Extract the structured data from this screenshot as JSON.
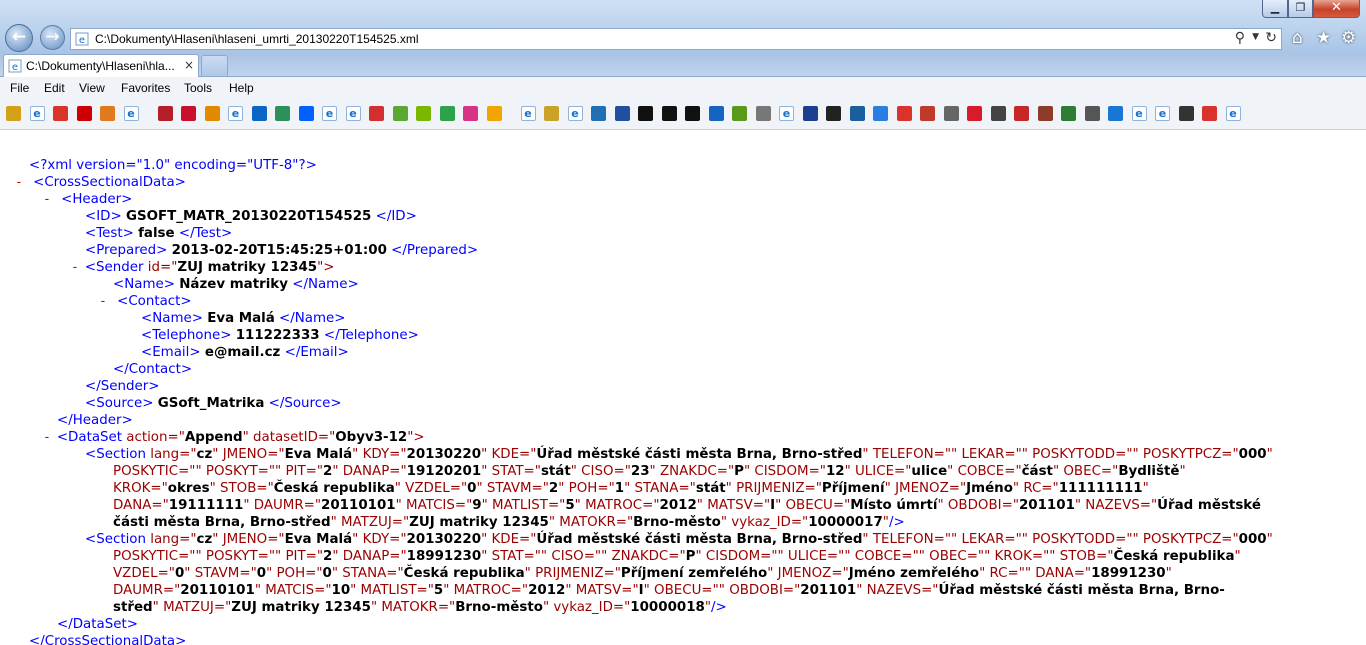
{
  "window": {
    "address": "C:\\Dokumenty\\Hlaseni\\hlaseni_umrti_20130220T154525.xml",
    "tab_label": "C:\\Dokumenty\\Hlaseni\\hla...",
    "tab_close": "×",
    "min_glyph": "▁",
    "max_glyph": "❐",
    "close_glyph": "✕",
    "back_glyph": "←",
    "forward_glyph": "→",
    "search_glyph": "⚲",
    "dropdown_glyph": "▼",
    "refresh_glyph": "↻",
    "home_glyph": "⌂",
    "favorites_glyph": "★",
    "tools_glyph": "⚙"
  },
  "menu": {
    "file": "File",
    "edit": "Edit",
    "view": "View",
    "favorites": "Favorites",
    "tools": "Tools",
    "help": "Help"
  },
  "colors": {
    "xml_markup": "#0000ff",
    "xml_tag": "#990000",
    "xml_minus": "#cc0000"
  },
  "favorites_icons": [
    "star-add",
    "ie-page",
    "tomato",
    "youtube",
    "pencil",
    "ie-page",
    "seznam",
    "target",
    "chart",
    "ie-page",
    "linkedin",
    "globe",
    "dropbox",
    "ie-page",
    "ie-page",
    "lips",
    "pinwheel",
    "y-letter",
    "stickman",
    "flower",
    "owl",
    "ie-page",
    "star",
    "ie-page",
    "book",
    "arrows",
    "circle-a",
    "circle-b",
    "circle-c",
    "puzzle",
    "map-pin",
    "doc",
    "ie-page",
    "table",
    "checker",
    "building",
    "bricks",
    "ring",
    "office",
    "tools",
    "snake",
    "monitor",
    "red-circle",
    "castle",
    "chart2",
    "diamond",
    "network",
    "ie-page",
    "ie-page",
    "list",
    "asterisk",
    "ie-page"
  ],
  "xml": {
    "decl": "<?xml version=\"1.0\" encoding=\"UTF-8\"?>",
    "minus": "-",
    "root_open": "<CrossSectionalData>",
    "header_open": "<Header>",
    "id_open": "<ID>",
    "id_val": "GSOFT_MATR_20130220T154525",
    "id_close": "</ID>",
    "test_open": "<Test>",
    "test_val": "false",
    "test_close": "</Test>",
    "prepared_open": "<Prepared>",
    "prepared_val": "2013-02-20T15:45:25+01:00",
    "prepared_close": "</Prepared>",
    "sender_open_a": "<Sender",
    "sender_attr": " id=\"",
    "sender_id": "ZUJ matriky 12345",
    "sender_open_b": "\">",
    "name_open": "<Name>",
    "sender_name": "Název matriky",
    "name_close": "</Name>",
    "contact_open": "<Contact>",
    "contact_name": "Eva Malá",
    "tel_open": "<Telephone>",
    "tel_val": "111222333",
    "tel_close": "</Telephone>",
    "email_open": "<Email>",
    "email_val": "e@mail.cz",
    "email_close": "</Email>",
    "contact_close": "</Contact>",
    "sender_close": "</Sender>",
    "source_open": "<Source>",
    "source_val": "GSoft_Matrika",
    "source_close": "</Source>",
    "header_close": "</Header>",
    "dataset_a": "<DataSet",
    "dataset_b": " action=\"",
    "dataset_action": "Append",
    "dataset_c": "\" datasetID=\"",
    "dataset_id": "Obyv3-12",
    "dataset_d": "\">",
    "dataset_close": "</DataSet>",
    "root_close": "</CrossSectionalData>",
    "sections": [
      [
        [
          {
            "k": "b",
            "t": "<Section"
          },
          {
            "k": "t",
            "t": " lang=\""
          },
          {
            "k": "v",
            "t": "cz"
          },
          {
            "k": "t",
            "t": "\" JMENO=\""
          },
          {
            "k": "v",
            "t": "Eva Malá"
          },
          {
            "k": "t",
            "t": "\" KDY=\""
          },
          {
            "k": "v",
            "t": "20130220"
          },
          {
            "k": "t",
            "t": "\" KDE=\""
          },
          {
            "k": "v",
            "t": "Úřad městské části města Brna, Brno-střed"
          },
          {
            "k": "t",
            "t": "\" TELEFON=\"\" LEKAR=\"\" POSKYTODD=\"\" POSKYTPCZ=\""
          },
          {
            "k": "v",
            "t": "000"
          },
          {
            "k": "t",
            "t": "\""
          }
        ],
        [
          {
            "k": "t",
            "t": "POSKYTIC=\"\" POSKYT=\"\" PIT=\""
          },
          {
            "k": "v",
            "t": "2"
          },
          {
            "k": "t",
            "t": "\" DANAP=\""
          },
          {
            "k": "v",
            "t": "19120201"
          },
          {
            "k": "t",
            "t": "\" STAT=\""
          },
          {
            "k": "v",
            "t": "stát"
          },
          {
            "k": "t",
            "t": "\" CISO=\""
          },
          {
            "k": "v",
            "t": "23"
          },
          {
            "k": "t",
            "t": "\" ZNAKDC=\""
          },
          {
            "k": "v",
            "t": "P"
          },
          {
            "k": "t",
            "t": "\" CISDOM=\""
          },
          {
            "k": "v",
            "t": "12"
          },
          {
            "k": "t",
            "t": "\" ULICE=\""
          },
          {
            "k": "v",
            "t": "ulice"
          },
          {
            "k": "t",
            "t": "\" COBCE=\""
          },
          {
            "k": "v",
            "t": "část"
          },
          {
            "k": "t",
            "t": "\" OBEC=\""
          },
          {
            "k": "v",
            "t": "Bydliště"
          },
          {
            "k": "t",
            "t": "\""
          }
        ],
        [
          {
            "k": "t",
            "t": "KROK=\""
          },
          {
            "k": "v",
            "t": "okres"
          },
          {
            "k": "t",
            "t": "\" STOB=\""
          },
          {
            "k": "v",
            "t": "Česká republika"
          },
          {
            "k": "t",
            "t": "\" VZDEL=\""
          },
          {
            "k": "v",
            "t": "0"
          },
          {
            "k": "t",
            "t": "\" STAVM=\""
          },
          {
            "k": "v",
            "t": "2"
          },
          {
            "k": "t",
            "t": "\" POH=\""
          },
          {
            "k": "v",
            "t": "1"
          },
          {
            "k": "t",
            "t": "\" STANA=\""
          },
          {
            "k": "v",
            "t": "stát"
          },
          {
            "k": "t",
            "t": "\" PRIJMENIZ=\""
          },
          {
            "k": "v",
            "t": "Příjmení"
          },
          {
            "k": "t",
            "t": "\" JMENOZ=\""
          },
          {
            "k": "v",
            "t": "Jméno"
          },
          {
            "k": "t",
            "t": "\" RC=\""
          },
          {
            "k": "v",
            "t": "111111111"
          },
          {
            "k": "t",
            "t": "\""
          }
        ],
        [
          {
            "k": "t",
            "t": "DANA=\""
          },
          {
            "k": "v",
            "t": "19111111"
          },
          {
            "k": "t",
            "t": "\" DAUMR=\""
          },
          {
            "k": "v",
            "t": "20110101"
          },
          {
            "k": "t",
            "t": "\" MATCIS=\""
          },
          {
            "k": "v",
            "t": "9"
          },
          {
            "k": "t",
            "t": "\" MATLIST=\""
          },
          {
            "k": "v",
            "t": "5"
          },
          {
            "k": "t",
            "t": "\" MATROC=\""
          },
          {
            "k": "v",
            "t": "2012"
          },
          {
            "k": "t",
            "t": "\" MATSV=\""
          },
          {
            "k": "v",
            "t": "I"
          },
          {
            "k": "t",
            "t": "\" OBECU=\""
          },
          {
            "k": "v",
            "t": "Místo úmrtí"
          },
          {
            "k": "t",
            "t": "\" OBDOBI=\""
          },
          {
            "k": "v",
            "t": "201101"
          },
          {
            "k": "t",
            "t": "\" NAZEVS=\""
          },
          {
            "k": "v",
            "t": "Úřad městské"
          }
        ],
        [
          {
            "k": "v",
            "t": "části města Brna, Brno-střed"
          },
          {
            "k": "t",
            "t": "\" MATZUJ=\""
          },
          {
            "k": "v",
            "t": "ZUJ matriky 12345"
          },
          {
            "k": "t",
            "t": "\" MATOKR=\""
          },
          {
            "k": "v",
            "t": "Brno-město"
          },
          {
            "k": "t",
            "t": "\" vykaz_ID=\""
          },
          {
            "k": "v",
            "t": "10000017"
          },
          {
            "k": "t",
            "t": "\""
          },
          {
            "k": "b",
            "t": "/>"
          }
        ]
      ],
      [
        [
          {
            "k": "b",
            "t": "<Section"
          },
          {
            "k": "t",
            "t": " lang=\""
          },
          {
            "k": "v",
            "t": "cz"
          },
          {
            "k": "t",
            "t": "\" JMENO=\""
          },
          {
            "k": "v",
            "t": "Eva Malá"
          },
          {
            "k": "t",
            "t": "\" KDY=\""
          },
          {
            "k": "v",
            "t": "20130220"
          },
          {
            "k": "t",
            "t": "\" KDE=\""
          },
          {
            "k": "v",
            "t": "Úřad městské části města Brna, Brno-střed"
          },
          {
            "k": "t",
            "t": "\" TELEFON=\"\" LEKAR=\"\" POSKYTODD=\"\" POSKYTPCZ=\""
          },
          {
            "k": "v",
            "t": "000"
          },
          {
            "k": "t",
            "t": "\""
          }
        ],
        [
          {
            "k": "t",
            "t": "POSKYTIC=\"\" POSKYT=\"\" PIT=\""
          },
          {
            "k": "v",
            "t": "2"
          },
          {
            "k": "t",
            "t": "\" DANAP=\""
          },
          {
            "k": "v",
            "t": "18991230"
          },
          {
            "k": "t",
            "t": "\" STAT=\"\" CISO=\"\" ZNAKDC=\""
          },
          {
            "k": "v",
            "t": "P"
          },
          {
            "k": "t",
            "t": "\" CISDOM=\"\" ULICE=\"\" COBCE=\"\" OBEC=\"\" KROK=\"\" STOB=\""
          },
          {
            "k": "v",
            "t": "Česká republika"
          },
          {
            "k": "t",
            "t": "\""
          }
        ],
        [
          {
            "k": "t",
            "t": "VZDEL=\""
          },
          {
            "k": "v",
            "t": "0"
          },
          {
            "k": "t",
            "t": "\" STAVM=\""
          },
          {
            "k": "v",
            "t": "0"
          },
          {
            "k": "t",
            "t": "\" POH=\""
          },
          {
            "k": "v",
            "t": "0"
          },
          {
            "k": "t",
            "t": "\" STANA=\""
          },
          {
            "k": "v",
            "t": "Česká republika"
          },
          {
            "k": "t",
            "t": "\" PRIJMENIZ=\""
          },
          {
            "k": "v",
            "t": "Příjmení zemřelého"
          },
          {
            "k": "t",
            "t": "\" JMENOZ=\""
          },
          {
            "k": "v",
            "t": "Jméno zemřelého"
          },
          {
            "k": "t",
            "t": "\" RC=\"\" DANA=\""
          },
          {
            "k": "v",
            "t": "18991230"
          },
          {
            "k": "t",
            "t": "\""
          }
        ],
        [
          {
            "k": "t",
            "t": "DAUMR=\""
          },
          {
            "k": "v",
            "t": "20110101"
          },
          {
            "k": "t",
            "t": "\" MATCIS=\""
          },
          {
            "k": "v",
            "t": "10"
          },
          {
            "k": "t",
            "t": "\" MATLIST=\""
          },
          {
            "k": "v",
            "t": "5"
          },
          {
            "k": "t",
            "t": "\" MATROC=\""
          },
          {
            "k": "v",
            "t": "2012"
          },
          {
            "k": "t",
            "t": "\" MATSV=\""
          },
          {
            "k": "v",
            "t": "I"
          },
          {
            "k": "t",
            "t": "\" OBECU=\"\" OBDOBI=\""
          },
          {
            "k": "v",
            "t": "201101"
          },
          {
            "k": "t",
            "t": "\" NAZEVS=\""
          },
          {
            "k": "v",
            "t": "Úřad městské části města Brna, Brno-"
          }
        ],
        [
          {
            "k": "v",
            "t": "střed"
          },
          {
            "k": "t",
            "t": "\" MATZUJ=\""
          },
          {
            "k": "v",
            "t": "ZUJ matriky 12345"
          },
          {
            "k": "t",
            "t": "\" MATOKR=\""
          },
          {
            "k": "v",
            "t": "Brno-město"
          },
          {
            "k": "t",
            "t": "\" vykaz_ID=\""
          },
          {
            "k": "v",
            "t": "10000018"
          },
          {
            "k": "t",
            "t": "\""
          },
          {
            "k": "b",
            "t": "/>"
          }
        ]
      ]
    ]
  }
}
